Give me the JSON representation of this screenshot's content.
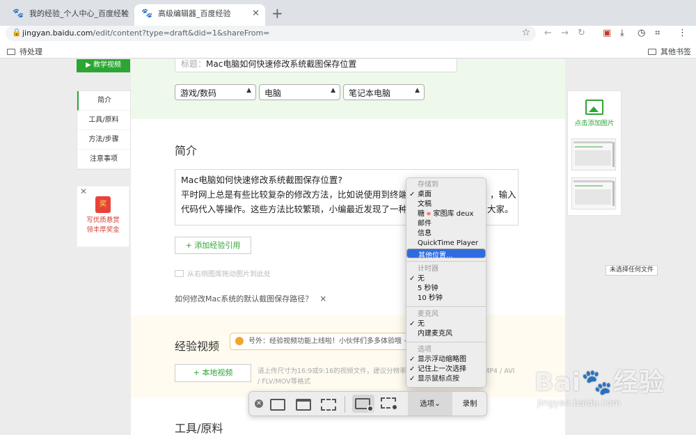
{
  "browser": {
    "tabs": [
      {
        "title": "我的经验_个人中心_百度经验",
        "active": false
      },
      {
        "title": "高级编辑器_百度经验",
        "active": true
      }
    ],
    "new_tab": "+",
    "url_host": "jingyan.baidu.com",
    "url_path": "/edit/content?type=draft&did=1&shareFrom=",
    "bookmarks": {
      "left": "待处理",
      "right": "其他书签"
    }
  },
  "editor": {
    "teach_video_btn": "教学视频",
    "title_label": "标题：",
    "title_value": "Mac电脑如何快速修改系统截图保存位置",
    "categories": [
      "游戏/数码",
      "电脑",
      "笔记本电脑"
    ],
    "intro_heading": "简介",
    "intro_text_line1": "Mac电脑如何快速修改系统截图保存位置?",
    "intro_text_line2": "平时网上总是有些比较复杂的修改方法，比如说使用到终端",
    "intro_text_line2_end": "，输入",
    "intro_text_line3": "代码代入等操作。这些方法比较繁琐，小编最近发现了一种",
    "intro_text_line3_end": "大家。",
    "add_ref_btn": "+ 添加经验引用",
    "drag_hint": "从右侧图库拖动图片到此处",
    "question": "如何修改Mac系统的默认截图保存路径？",
    "question_close": "×",
    "video_heading": "经验视频",
    "video_tip": "号外：经验视频功能上线啦！小伙伴们多多体验哦 ~",
    "local_video_btn": "+ 本地视频",
    "video_note_1": "请上传尺寸为16:9或9:16的视频文件，建议分辨率",
    "video_note_1_end": "MP4 / AVI",
    "video_note_2": "/ FLV/MOV等格式",
    "tools_heading": "工具/原料"
  },
  "leftnav": {
    "items": [
      "简介",
      "工具/原料",
      "方法/步骤",
      "注意事项"
    ],
    "promo_badge": "奖",
    "promo_line1": "写优质悬赏",
    "promo_line2": "领丰厚奖金"
  },
  "rightpanel": {
    "add_image": "点击添加图片"
  },
  "tooltip_no_file": "未选择任何文件",
  "capture_menu": {
    "save_to_header": "存储到",
    "save_to": [
      {
        "label": "桌面",
        "checked": true
      },
      {
        "label": "文稿",
        "checked": false
      },
      {
        "label": "糖🍬家图库 deux",
        "checked": false
      },
      {
        "label": "邮件",
        "checked": false
      },
      {
        "label": "信息",
        "checked": false
      },
      {
        "label": "QuickTime Player",
        "checked": false
      },
      {
        "label": "其他位置...",
        "checked": false,
        "selected": true
      }
    ],
    "timer_header": "计时器",
    "timer": [
      {
        "label": "无",
        "checked": true
      },
      {
        "label": "5 秒钟",
        "checked": false
      },
      {
        "label": "10 秒钟",
        "checked": false
      }
    ],
    "mic_header": "麦克风",
    "mic": [
      {
        "label": "无",
        "checked": true
      },
      {
        "label": "内建麦克风",
        "checked": false
      }
    ],
    "options_header": "选项",
    "options": [
      {
        "label": "显示浮动缩略图",
        "checked": true
      },
      {
        "label": "记住上一次选择",
        "checked": true
      },
      {
        "label": "显示鼠标点按",
        "checked": true
      }
    ]
  },
  "capture_toolbar": {
    "options_label": "选项⌄",
    "record_label": "录制"
  },
  "watermark": {
    "main": "Bai🐾经验",
    "sub": "jingyan.baidu.com"
  }
}
